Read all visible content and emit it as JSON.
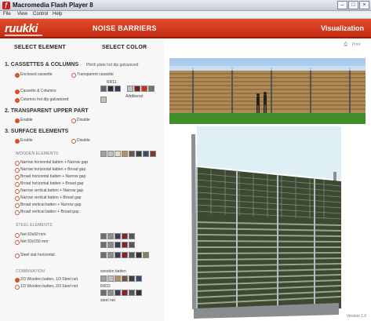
{
  "window": {
    "title": "Macromedia Flash Player 8"
  },
  "menu": [
    "File",
    "View",
    "Control",
    "Help"
  ],
  "header": {
    "logo": "ruukki",
    "title": "NOISE BARRIERS",
    "visualization": "Visualization"
  },
  "left": {
    "select_element": "SELECT ELEMENT",
    "select_color": "SELECT COLOR",
    "s1": {
      "title": "1. CASSETTES & COLUMNS",
      "note": "Plinth plate hot dip galvanized",
      "opt_enclosed": "Enclosed cassette",
      "opt_transparent": "Transparent cassette",
      "opt_cassette": "Cassette & Columns",
      "opt_columns": "Columns hot dip galvanized",
      "rr11": "RR11",
      "additional": "Additional"
    },
    "s2": {
      "title": "2. TRANSPARENT UPPER PART",
      "enable": "Enable",
      "disable": "Disable"
    },
    "s3": {
      "title": "3. SURFACE ELEMENTS",
      "enable": "Enable",
      "disable": "Disable",
      "wooden_title": "WOODEN ELEMENTS",
      "wooden": [
        "Narrow horizontal batten + Narrow gap",
        "Narrow horizontal batten + Broad gap",
        "Broad horizontal batten + Narrow gap",
        "Broad horizontal batten + Broad gap",
        "Narrow vertical batten + Narrow gap",
        "Narrow vertical batten + Broad gap",
        "Broad vertical batten + Narrow gap",
        "Broad vertical batten + Broad gap"
      ],
      "steel_title": "STEEL ELEMENTS",
      "steel": [
        "Net 60x60 mm",
        "Net 50x150 mm",
        "Steel slat horizontal"
      ],
      "combo_title": "COMBINATION",
      "combo": [
        "2/3 Wooden batten, 1/3 Steel net",
        "1/3 Wooden batten, 2/3 Steel net"
      ],
      "wooden_batten": "wooden batten",
      "rr22": "RR22",
      "steel_net": "steel net"
    }
  },
  "right": {
    "print": "Print",
    "version": "Version 1.0"
  },
  "colors": {
    "accent": "#d2351a",
    "rr11_swatches": [
      "#5c6570",
      "#2b2f3a",
      "#3a3560",
      "#c0c0c0"
    ],
    "additional_swatches": [
      "#7b1f1b",
      "#d23019",
      "#6b7a5c"
    ],
    "wooden_swatches": [
      "#9aa0a6",
      "#c0c4c9",
      "#e8dcc4",
      "#b89060",
      "#6c5a4a",
      "#3e3e3e",
      "#3a4a6a",
      "#555",
      "#7a3a2a"
    ],
    "steel_swatches_1": [
      "#6b6e74",
      "#8a8d92",
      "#3d3a5a",
      "#8a1f2a",
      "#555"
    ],
    "steel_swatches_2": [
      "#6b6e74",
      "#8a8d92",
      "#3d3a5a",
      "#8a1f2a",
      "#555"
    ],
    "steel_swatches_3": [
      "#6b6e74",
      "#8a8d92",
      "#3d3a5a",
      "#8a1f2a",
      "#555",
      "#333",
      "#7a8a5a"
    ],
    "combo_wood": [
      "#9aa0a6",
      "#c0c4c9",
      "#b89060",
      "#6c5a4a",
      "#3e3e3e",
      "#3a4a6a"
    ],
    "combo_steel": [
      "#6b6e74",
      "#8a8d92",
      "#3d3a5a",
      "#8a1f2a",
      "#555",
      "#333"
    ]
  }
}
